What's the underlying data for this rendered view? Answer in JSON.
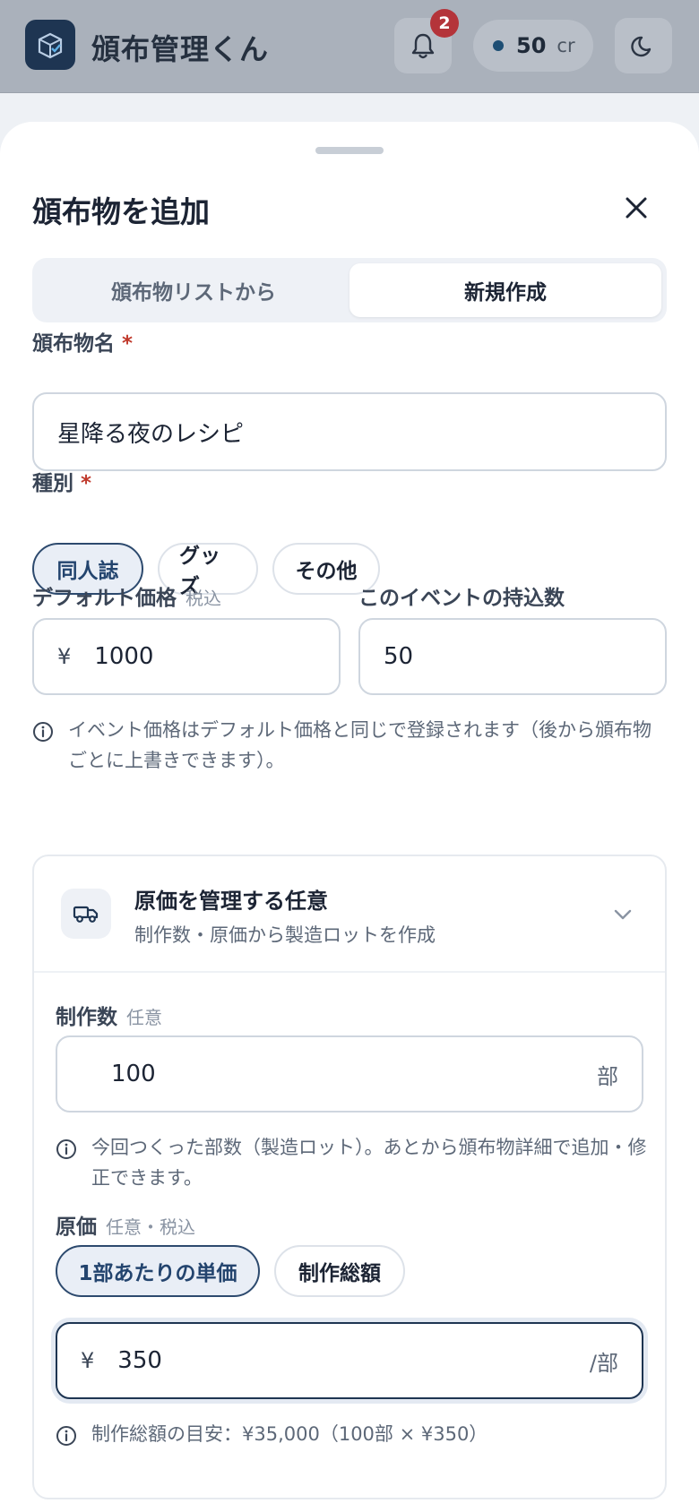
{
  "app": {
    "title": "頒布管理くん",
    "notification_count": "2",
    "credits_value": "50",
    "credits_unit": "cr"
  },
  "sheet": {
    "title": "頒布物を追加",
    "tabs": [
      {
        "label": "頒布物リストから",
        "active": false
      },
      {
        "label": "新規作成",
        "active": true
      }
    ],
    "name_label": "頒布物名",
    "required_mark": "*",
    "name_value": "星降る夜のレシピ",
    "type_label": "種別",
    "type_options": [
      {
        "label": "同人誌",
        "selected": true
      },
      {
        "label": "グッズ",
        "selected": false
      },
      {
        "label": "その他",
        "selected": false
      }
    ],
    "price_label": "デフォルト価格",
    "price_sub": "税込",
    "currency": "¥",
    "price_value": "1000",
    "stock_label": "このイベントの持込数",
    "stock_value": "50",
    "price_hint": "イベント価格はデフォルト価格と同じで登録されます（後から頒布物ごとに上書きできます）。"
  },
  "cost_card": {
    "title": "原価を管理する任意",
    "subtitle": "制作数・原価から製造ロットを作成",
    "qty_label": "制作数",
    "qty_sub": "任意",
    "qty_value": "100",
    "qty_unit": "部",
    "qty_hint": "今回つくった部数（製造ロット）。あとから頒布物詳細で追加・修正できます。",
    "cost_label": "原価",
    "cost_sub": "任意・税込",
    "cost_modes": [
      {
        "label": "1部あたりの単価",
        "selected": true
      },
      {
        "label": "制作総額",
        "selected": false
      }
    ],
    "cost_value": "350",
    "cost_unit": "/部",
    "total_hint": "制作総額の目安：¥35,000（100部 × ¥350）"
  },
  "colors": {
    "brand": "#1e3552",
    "accent_selected": "#23446e",
    "required": "#c0392b",
    "badge": "#b4343a"
  },
  "icons": [
    "app-logo-icon",
    "bell-icon",
    "moon-icon",
    "close-icon",
    "info-icon",
    "truck-icon",
    "chevron-down-icon"
  ]
}
